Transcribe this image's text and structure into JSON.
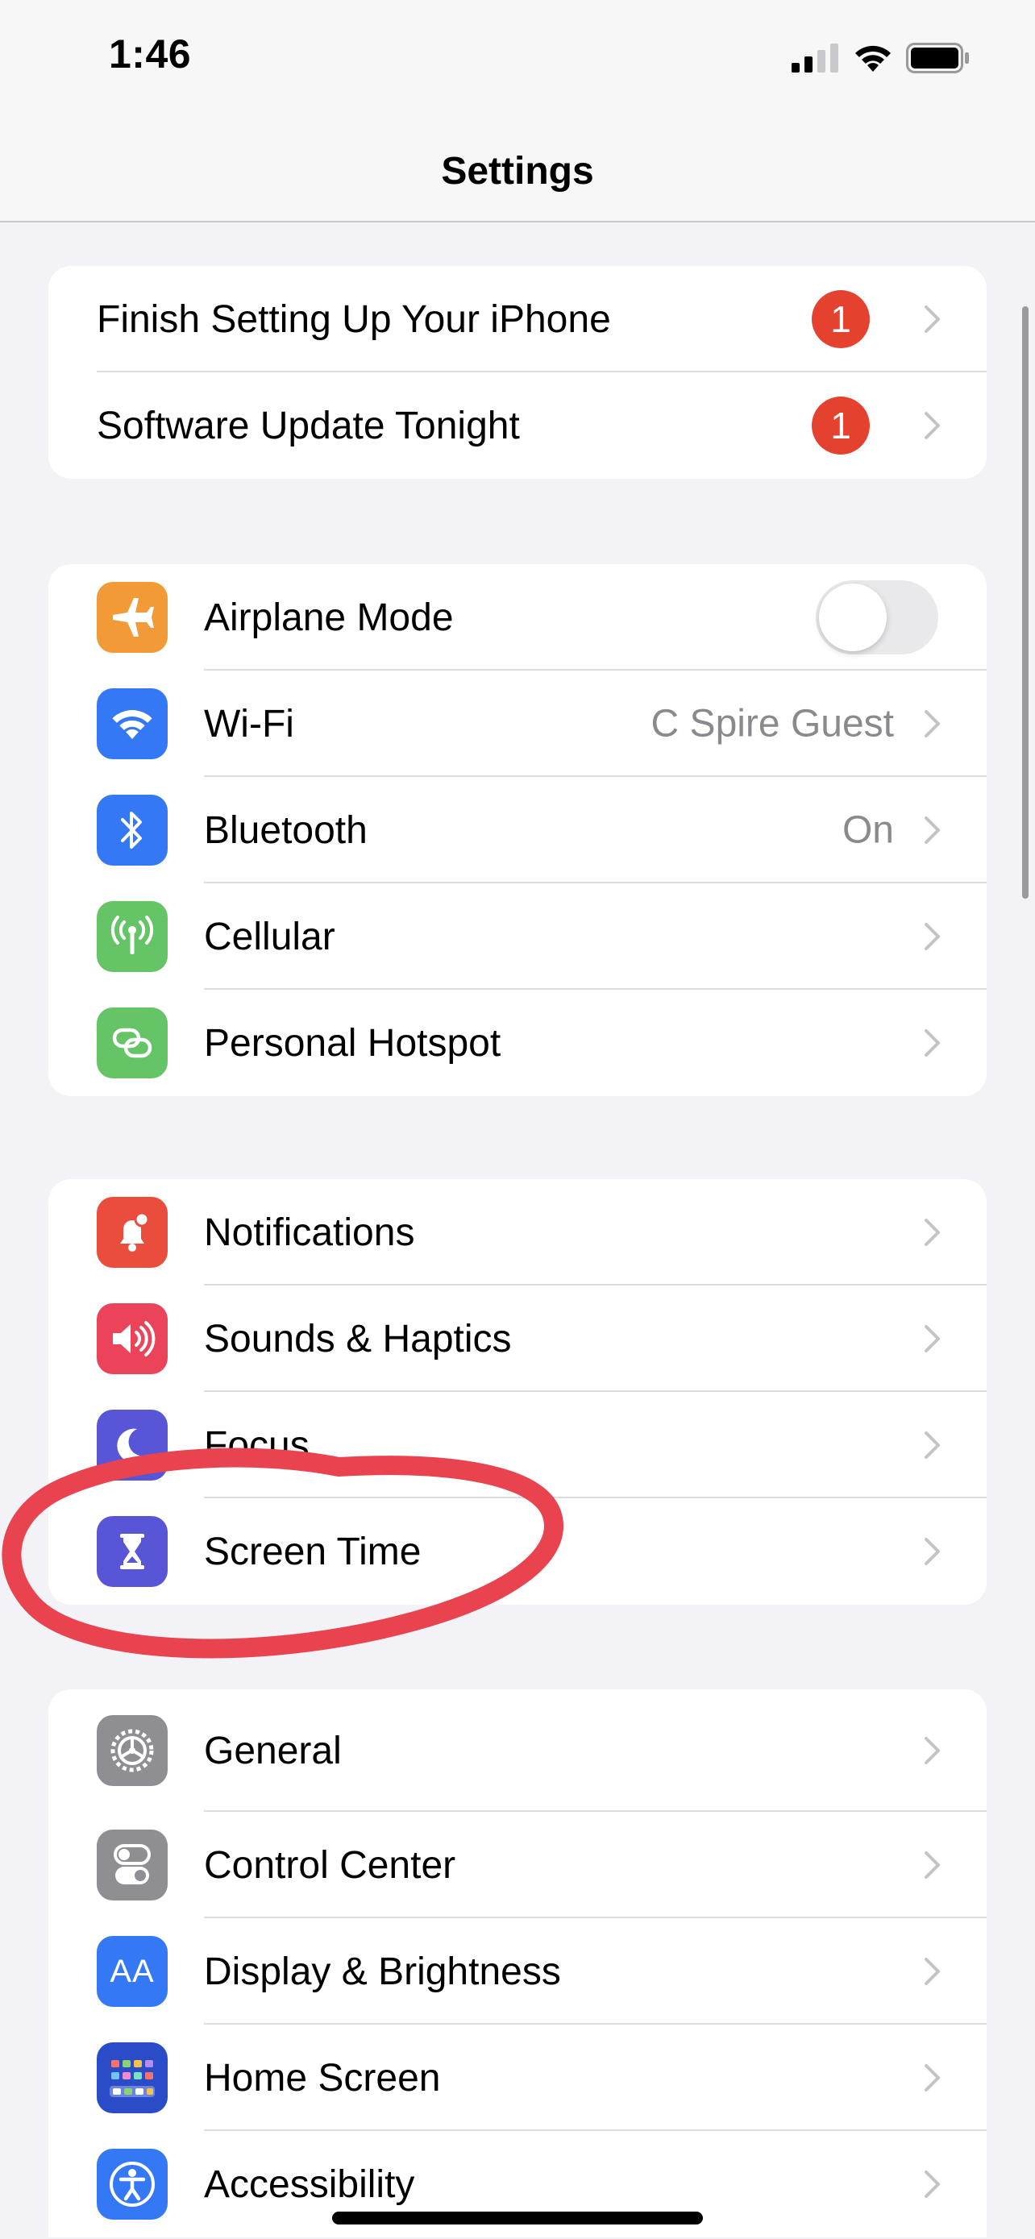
{
  "status_bar": {
    "time": "1:46"
  },
  "nav": {
    "title": "Settings"
  },
  "group_alerts": {
    "rows": [
      {
        "label": "Finish Setting Up Your iPhone",
        "badge": "1"
      },
      {
        "label": "Software Update Tonight",
        "badge": "1"
      }
    ]
  },
  "group_connectivity": {
    "rows": [
      {
        "label": "Airplane Mode",
        "icon": "airplane-icon",
        "color": "#f19a37",
        "toggle": "off"
      },
      {
        "label": "Wi-Fi",
        "icon": "wifi-icon",
        "color": "#3478f6",
        "value": "C Spire Guest"
      },
      {
        "label": "Bluetooth",
        "icon": "bluetooth-icon",
        "color": "#3478f6",
        "value": "On"
      },
      {
        "label": "Cellular",
        "icon": "cellular-antenna-icon",
        "color": "#65c466"
      },
      {
        "label": "Personal Hotspot",
        "icon": "hotspot-chain-icon",
        "color": "#65c466"
      }
    ]
  },
  "group_attention": {
    "rows": [
      {
        "label": "Notifications",
        "icon": "notification-bell-icon",
        "color": "#eb4d3d"
      },
      {
        "label": "Sounds & Haptics",
        "icon": "speaker-icon",
        "color": "#eb445a"
      },
      {
        "label": "Focus",
        "icon": "moon-icon",
        "color": "#5856d6"
      },
      {
        "label": "Screen Time",
        "icon": "hourglass-icon",
        "color": "#5856d6"
      }
    ]
  },
  "group_general": {
    "rows": [
      {
        "label": "General",
        "icon": "gear-icon",
        "color": "#8e8e93"
      },
      {
        "label": "Control Center",
        "icon": "toggles-icon",
        "color": "#8e8e93"
      },
      {
        "label": "Display & Brightness",
        "icon": "text-size-icon",
        "color": "#3478f6",
        "icon_text": "AA"
      },
      {
        "label": "Home Screen",
        "icon": "app-grid-icon",
        "color": "#2a4cc7"
      },
      {
        "label": "Accessibility",
        "icon": "accessibility-person-icon",
        "color": "#3478f6"
      }
    ]
  },
  "annotation": {
    "color": "#e8434f"
  }
}
